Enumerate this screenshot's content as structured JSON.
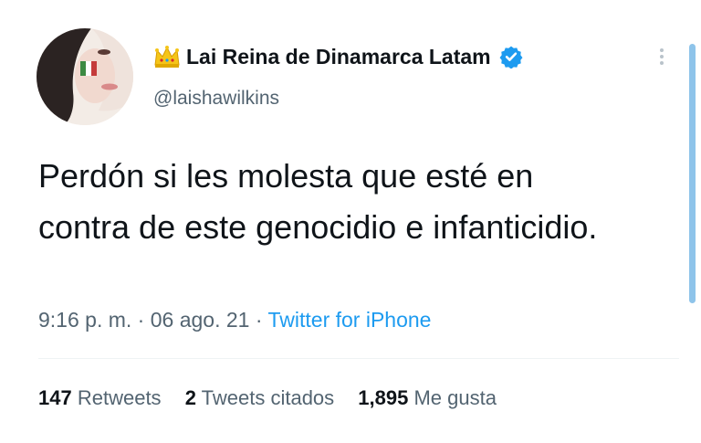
{
  "tweet": {
    "author": {
      "display_name": "Lai Reina de Dinamarca Latam",
      "handle": "@laishawilkins",
      "verified": true,
      "name_emoji": "crown-icon"
    },
    "text": "Perdón si les molesta que esté en contra de este genocidio e infanticidio.",
    "time": "9:16 p. m.",
    "date": "06 ago. 21",
    "separator": "·",
    "source": "Twitter for iPhone",
    "stats": {
      "retweets_count": "147",
      "retweets_label": "Retweets",
      "quotes_count": "2",
      "quotes_label": "Tweets citados",
      "likes_count": "1,895",
      "likes_label": "Me gusta"
    }
  },
  "colors": {
    "accent": "#1d9bf0",
    "secondary_text": "#536471",
    "primary_text": "#0f1419"
  }
}
